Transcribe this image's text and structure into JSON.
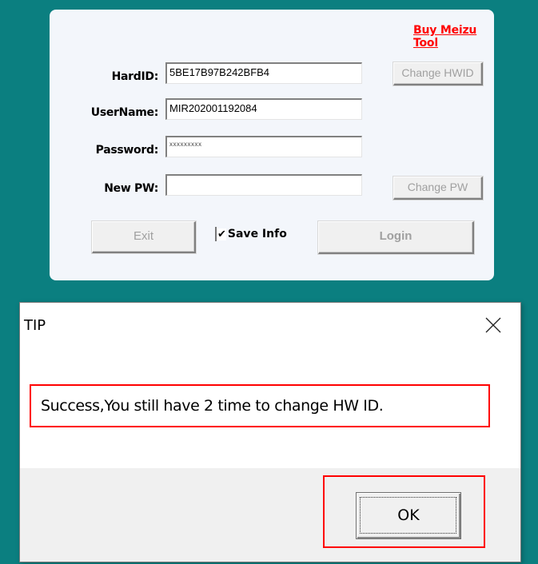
{
  "login_panel": {
    "buy_link": "Buy Meizu Tool",
    "fields": {
      "hardid": {
        "label": "HardID:",
        "value": "5BE17B97B242BFB4"
      },
      "username": {
        "label": "UserName:",
        "value": "MIR202001192084"
      },
      "password": {
        "label": "Password:",
        "value": "xxxxxxxxx"
      },
      "new_pw": {
        "label": "New PW:",
        "value": ""
      }
    },
    "buttons": {
      "change_hwid": "Change HWID",
      "change_pw": "Change PW",
      "exit": "Exit",
      "login": "Login"
    },
    "save_info": {
      "label": "Save Info",
      "checked": true,
      "check_glyph": "✔"
    }
  },
  "dialog": {
    "title": "TIP",
    "close_icon": "close-icon",
    "message": "Success,You still have 2 time to change HW ID.",
    "ok_label": "OK",
    "highlight_color": "#ff0000"
  },
  "colors": {
    "desktop_bg": "#0b7f80",
    "panel_bg": "#f3f6fb",
    "link": "#ff0000"
  }
}
